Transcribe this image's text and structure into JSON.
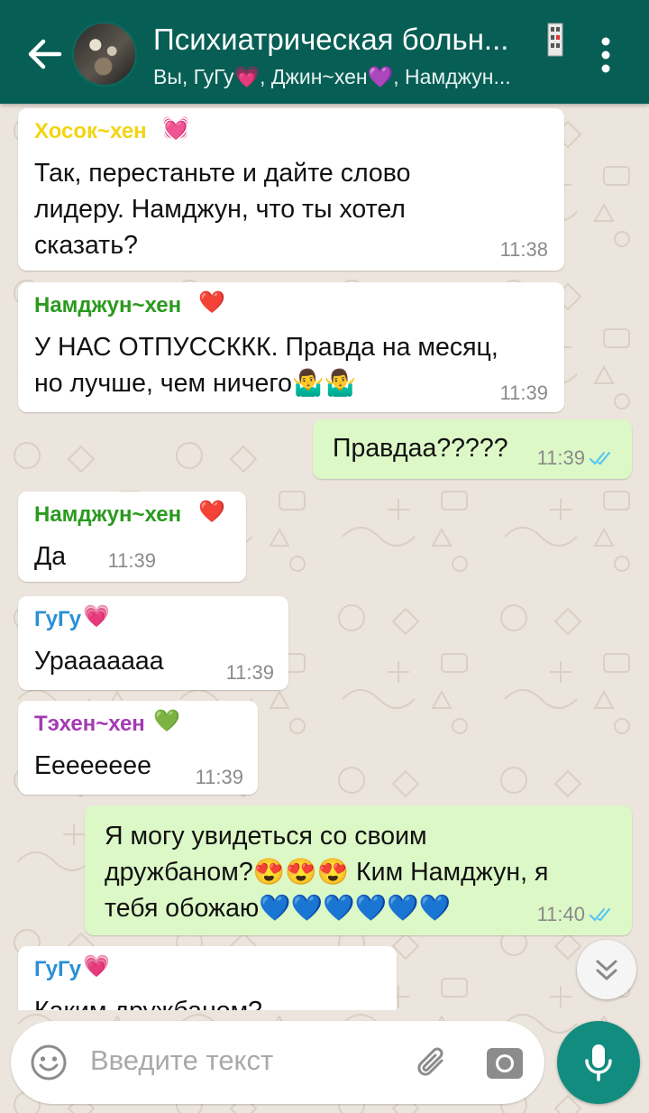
{
  "header": {
    "title": "Психиатрическая больн...",
    "subtitle": "Вы, ГуГу💗, Джин~хен💜, Намджун...",
    "back_icon": "arrow-left-icon",
    "menu_icon": "more-vert-icon",
    "bg_color": "#075e54"
  },
  "messages": [
    {
      "type": "in",
      "sender": "Хосок~хен",
      "sender_color": "#f2d513",
      "sender_emoji": "💓",
      "lines": [
        "Так, перестаньте и дайте слово",
        "лидеру. Намджун, что ты хотел",
        "сказать?"
      ],
      "time": "11:38"
    },
    {
      "type": "in",
      "sender": "Намджун~хен",
      "sender_color": "#2a9a1e",
      "sender_emoji": "❤️",
      "lines": [
        "У НАС ОТПУССККК. Правда на месяц,",
        "но лучше, чем ничего🤷‍♂️🤷‍♂️"
      ],
      "time": "11:39"
    },
    {
      "type": "out",
      "lines": [
        "Правдаа?????"
      ],
      "time": "11:39",
      "status": "read"
    },
    {
      "type": "in",
      "sender": "Намджун~хен",
      "sender_color": "#2a9a1e",
      "sender_emoji": "❤️",
      "lines": [
        "Да"
      ],
      "time": "11:39"
    },
    {
      "type": "in",
      "sender": "ГуГу",
      "sender_color": "#2a8fd6",
      "sender_emoji": "💗",
      "lines": [
        "Урааааааа"
      ],
      "time": "11:39"
    },
    {
      "type": "in",
      "sender": "Тэхен~хен",
      "sender_color": "#a43bb3",
      "sender_emoji": "💚",
      "lines": [
        "Ееееееее"
      ],
      "time": "11:39"
    },
    {
      "type": "out",
      "lines": [
        "Я могу увидеться со своим",
        "дружбаном?😍😍😍 Ким Намджун, я",
        "тебя обожаю💙💙💙💙💙💙"
      ],
      "time": "11:40",
      "status": "read"
    },
    {
      "type": "in",
      "sender": "ГуГу",
      "sender_color": "#2a8fd6",
      "sender_emoji": "💗",
      "lines": [
        "Каким дружбаном?"
      ],
      "time": ""
    }
  ],
  "input": {
    "placeholder": "Введите текст",
    "emoji_icon": "emoji-icon",
    "attach_icon": "paperclip-icon",
    "camera_icon": "camera-icon",
    "mic_icon": "mic-icon"
  },
  "scroll_icon": "double-chevron-down-icon",
  "colors": {
    "incoming_bubble": "#ffffff",
    "outgoing_bubble": "#dcf8c6",
    "accent": "#128c7e",
    "read_tick": "#4fc3f7",
    "wallpaper": "#ece5dd"
  }
}
